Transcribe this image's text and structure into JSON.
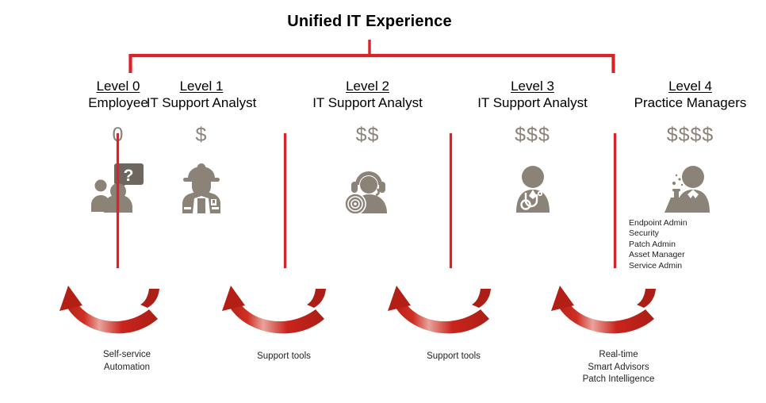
{
  "diagram": {
    "title": "Unified IT Experience",
    "accent_color": "#d8232a",
    "icon_color": "#8b8278",
    "text_color": "#231f1c",
    "bracket": {
      "label": "Unified IT Experience",
      "spans_levels": "Level 1 to Level 4"
    },
    "columns": [
      {
        "level_label": "Level 0",
        "role_label": "Employee",
        "cost": "0",
        "icon": "people-question-icon",
        "sub_roles": [],
        "caption": "Self-service\nAutomation",
        "caption_lines": [
          "Self-service",
          "Automation"
        ]
      },
      {
        "level_label": "Level 1",
        "role_label": "IT Support Analyst",
        "cost": "$",
        "icon": "hardhat-worker-icon",
        "sub_roles": [],
        "caption_lines": [
          "Support tools"
        ]
      },
      {
        "level_label": "Level 2",
        "role_label": "IT Support Analyst",
        "cost": "$$",
        "icon": "headset-agent-icon",
        "sub_roles": [],
        "caption_lines": [
          "Support tools"
        ]
      },
      {
        "level_label": "Level 3",
        "role_label": "IT Support Analyst",
        "cost": "$$$",
        "icon": "stethoscope-specialist-icon",
        "sub_roles": [],
        "caption_lines": []
      },
      {
        "level_label": "Level 4",
        "role_label": "Practice Managers",
        "cost": "$$$$",
        "icon": "scientist-flask-icon",
        "sub_roles": [
          "Endpoint Admin",
          "Security",
          "Patch Admin",
          "Asset Manager",
          "Service Admin"
        ],
        "caption_lines": [
          "Real-time",
          "Smart Advisors",
          "Patch Intelligence"
        ]
      }
    ],
    "captions": [
      {
        "lines": [
          "Self-service",
          "Automation"
        ]
      },
      {
        "lines": [
          "Support tools"
        ]
      },
      {
        "lines": [
          "Support tools"
        ]
      },
      {
        "lines": [
          "Real-time",
          "Smart Advisors",
          "Patch Intelligence"
        ]
      }
    ],
    "sub_roles_level4": [
      "Endpoint Admin",
      "Security",
      "Patch Admin",
      "Asset Manager",
      "Service Admin"
    ],
    "escalation_arrows": 4,
    "divider_count": 4
  }
}
